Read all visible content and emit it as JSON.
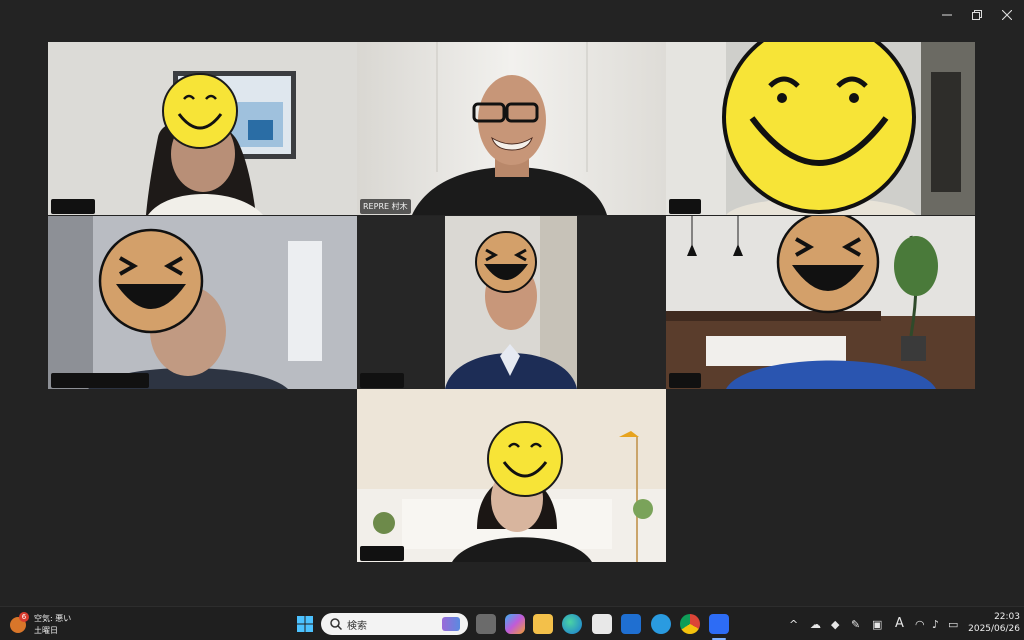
{
  "participants": [
    {
      "id": "p1",
      "label": "",
      "emoji": "smile-emoji",
      "active": false
    },
    {
      "id": "p2",
      "label": "REPRE 村木",
      "emoji": "none",
      "active": true
    },
    {
      "id": "p3",
      "label": "",
      "emoji": "smile-emoji",
      "active": false
    },
    {
      "id": "p4",
      "label": "",
      "emoji": "laugh-emoji",
      "active": false
    },
    {
      "id": "p5",
      "label": "",
      "emoji": "laugh-emoji",
      "active": false
    },
    {
      "id": "p6",
      "label": "",
      "emoji": "laugh-emoji",
      "active": false
    },
    {
      "id": "p7",
      "label": "",
      "emoji": "smile-emoji",
      "active": false
    }
  ],
  "weather": {
    "badge": "6",
    "line1": "空気: 悪い",
    "line2": "土曜日"
  },
  "search": {
    "placeholder": "検索"
  },
  "clock": {
    "time": "22:03",
    "date": "2025/06/26"
  },
  "ime": {
    "label": "A"
  },
  "colors": {
    "active_border": "#23d160",
    "emoji_yellow": "#f7e437",
    "emoji_tan": "#d3a06a"
  }
}
